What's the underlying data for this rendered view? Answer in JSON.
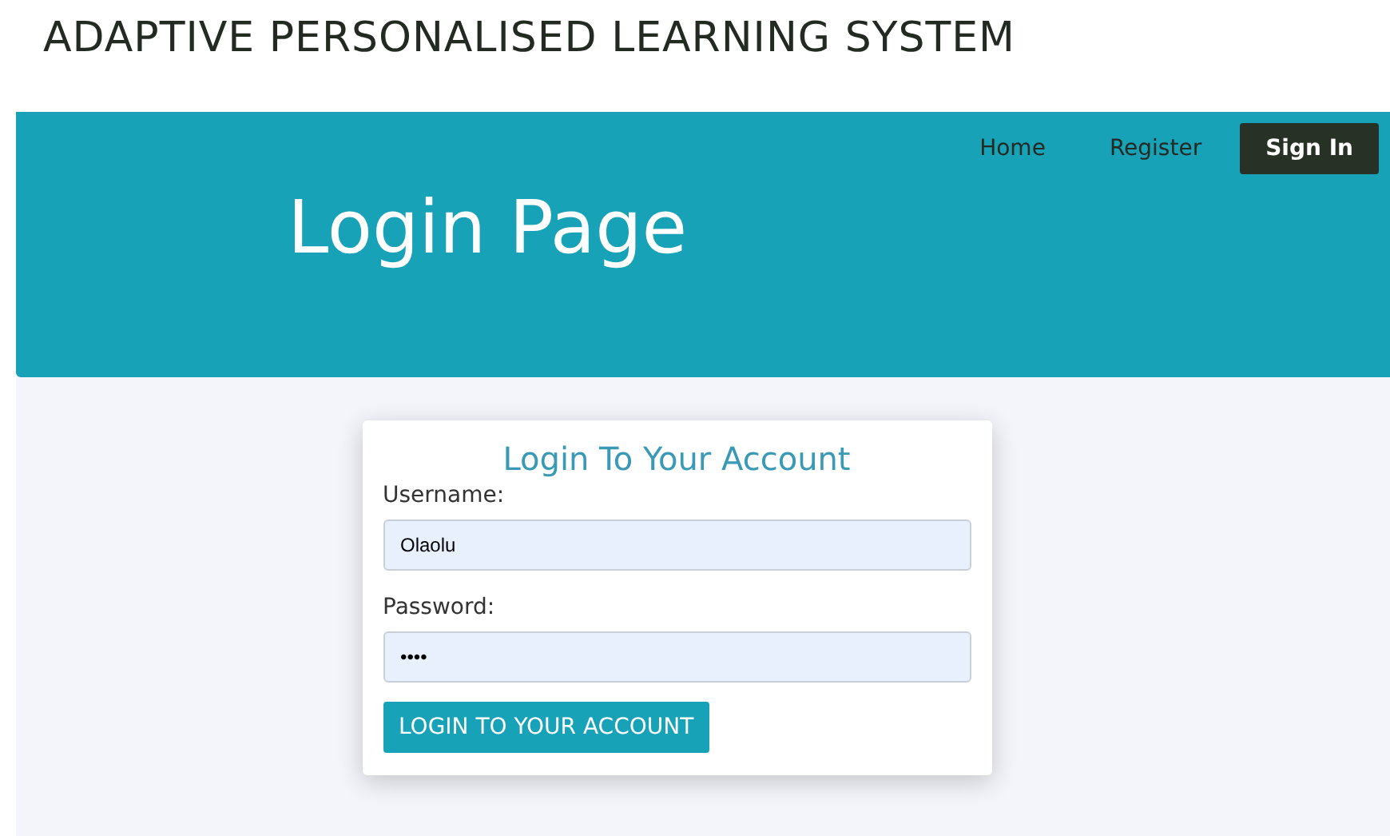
{
  "site_title": "ADAPTIVE PERSONALISED LEARNING SYSTEM",
  "nav": [
    {
      "label": "Home",
      "selected": false
    },
    {
      "label": "Register",
      "selected": false
    },
    {
      "label": "Sign In",
      "selected": true
    }
  ],
  "banner": {
    "heading": "Login Page"
  },
  "login_card": {
    "title": "Login To Your Account",
    "fields": [
      {
        "label": "Username:",
        "value": "Olaolu"
      },
      {
        "label": "Password:",
        "value": "••••"
      }
    ],
    "submit": "LOGIN TO YOUR ACCOUNT"
  }
}
